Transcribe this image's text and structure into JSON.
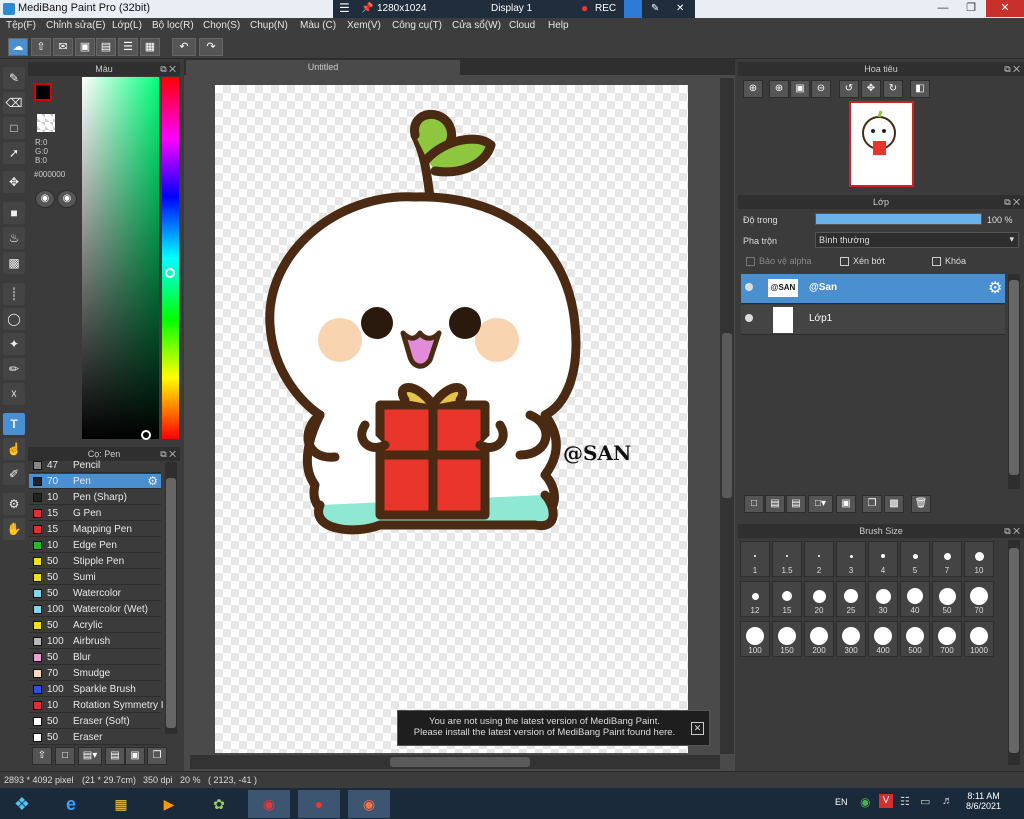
{
  "titlebar": {
    "title": "MediBang Paint Pro (32bit)"
  },
  "rdp": {
    "resolution": "1280x1024",
    "display": "Display 1",
    "rec": "REC"
  },
  "menu": [
    "Tệp(F)",
    "Chỉnh sửa(E)",
    "Lớp(L)",
    "Bộ lọc(R)",
    "Chọn(S)",
    "Chụp(N)",
    "Màu (C)",
    "Xem(V)",
    "Công cụ(T)",
    "Cửa sổ(W)",
    "Cloud",
    "Help"
  ],
  "color_panel": {
    "title": "Màu",
    "r": "R:0",
    "g": "G:0",
    "b": "B:0",
    "hex": "#000000"
  },
  "brush_panel": {
    "title": "Cọ: Pen",
    "brushes": [
      {
        "size": "47",
        "name": "Pencil",
        "color": "#888888"
      },
      {
        "size": "70",
        "name": "Pen",
        "color": "#222222"
      },
      {
        "size": "10",
        "name": "Pen (Sharp)",
        "color": "#222222"
      },
      {
        "size": "15",
        "name": "G Pen",
        "color": "#e03030"
      },
      {
        "size": "15",
        "name": "Mapping Pen",
        "color": "#e03030"
      },
      {
        "size": "10",
        "name": "Edge Pen",
        "color": "#22bb22"
      },
      {
        "size": "50",
        "name": "Stipple Pen",
        "color": "#f0e020"
      },
      {
        "size": "50",
        "name": "Sumi",
        "color": "#f0e020"
      },
      {
        "size": "50",
        "name": "Watercolor",
        "color": "#80d8f0"
      },
      {
        "size": "100",
        "name": "Watercolor (Wet)",
        "color": "#80d8f0"
      },
      {
        "size": "50",
        "name": "Acrylic",
        "color": "#f0e020"
      },
      {
        "size": "100",
        "name": "Airbrush",
        "color": "#b8b8b8"
      },
      {
        "size": "50",
        "name": "Blur",
        "color": "#f0a0d8"
      },
      {
        "size": "70",
        "name": "Smudge",
        "color": "#f8d8c0"
      },
      {
        "size": "100",
        "name": "Sparkle Brush",
        "color": "#3050e0"
      },
      {
        "size": "10",
        "name": "Rotation Symmetry I",
        "color": "#e03030"
      },
      {
        "size": "50",
        "name": "Eraser (Soft)",
        "color": "#ffffff"
      },
      {
        "size": "50",
        "name": "Eraser",
        "color": "#ffffff"
      }
    ]
  },
  "canvas": {
    "tab": "Untitled",
    "signature": "@SAN"
  },
  "notice": {
    "line1": "You are not using the latest version of MediBang Paint.",
    "line2": "Please install the latest version of MediBang Paint found here."
  },
  "navigator": {
    "title": "Hoa tiêu"
  },
  "layers": {
    "title": "Lớp",
    "opacity_label": "Độ trong",
    "opacity_value": "100 %",
    "opacity": 1.0,
    "blend_label": "Pha trộn",
    "blend_value": "Bình thường",
    "protect_alpha": "Bảo vệ alpha",
    "clipping": "Xén bớt",
    "lock": "Khóa",
    "items": [
      {
        "name": "@San",
        "thumb": "@SAN"
      },
      {
        "name": "Lớp1",
        "thumb": ""
      }
    ]
  },
  "brush_size": {
    "title": "Brush Size",
    "sizes": [
      "1",
      "1.5",
      "2",
      "3",
      "4",
      "5",
      "7",
      "10",
      "12",
      "15",
      "20",
      "25",
      "30",
      "40",
      "50",
      "70",
      "100",
      "150",
      "200",
      "300",
      "400",
      "500",
      "700",
      "1000"
    ]
  },
  "status": {
    "dims": "2893 * 4092 pixel",
    "cm": "(21 * 29.7cm)",
    "dpi": "350 dpi",
    "zoom": "20 %",
    "coords": "( 2123, -41 )"
  },
  "taskbar": {
    "lang": "EN",
    "time": "8:11 AM",
    "date": "8/6/2021"
  }
}
